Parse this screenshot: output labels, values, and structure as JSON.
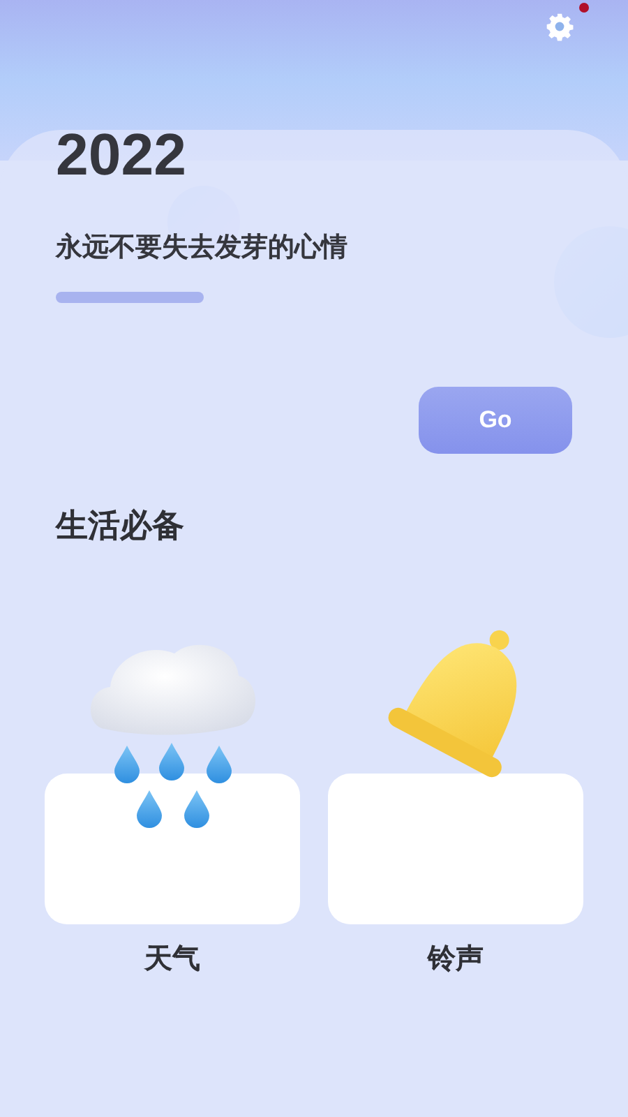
{
  "header": {
    "settings": {
      "has_notification": true
    }
  },
  "hero": {
    "year": "2022",
    "slogan": "永远不要失去发芽的心情",
    "button": "Go"
  },
  "section": {
    "title": "生活必备"
  },
  "tools": [
    {
      "kind": "weather",
      "label": "天气"
    },
    {
      "kind": "bell",
      "label": "铃声"
    }
  ]
}
